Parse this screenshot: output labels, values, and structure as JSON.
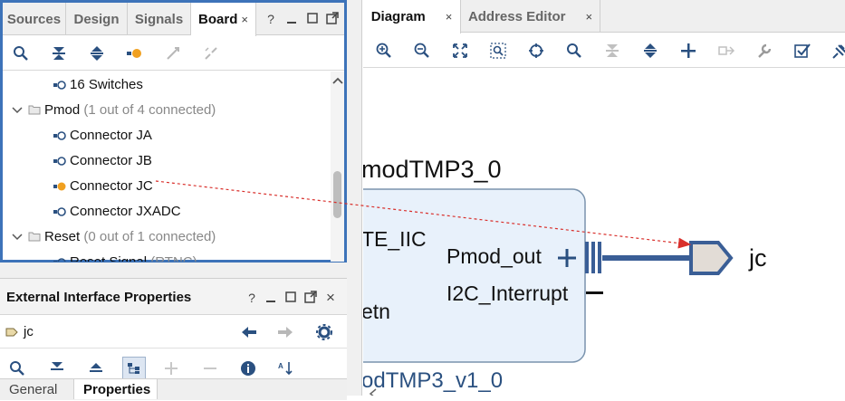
{
  "board": {
    "tabs": [
      {
        "label": "Sources",
        "active": false
      },
      {
        "label": "Design",
        "active": false
      },
      {
        "label": "Signals",
        "active": false
      },
      {
        "label": "Board",
        "active": true
      }
    ],
    "window_buttons": [
      "?",
      "_",
      "□",
      "⤢"
    ],
    "toolbar_icons": [
      "search-icon",
      "collapse-all-icon",
      "expand-all-icon",
      "auto-connect-icon",
      "connect-icon",
      "disconnect-icon"
    ],
    "tree": [
      {
        "label": "16 Switches",
        "meta": "",
        "type": "connector",
        "connected": false
      },
      {
        "label": "Pmod",
        "meta": "(1 out of 4 connected)",
        "type": "folder"
      },
      {
        "label": "Connector JA",
        "meta": "",
        "type": "connector",
        "connected": false
      },
      {
        "label": "Connector JB",
        "meta": "",
        "type": "connector",
        "connected": false
      },
      {
        "label": "Connector JC",
        "meta": "",
        "type": "connector",
        "connected": true
      },
      {
        "label": "Connector JXADC",
        "meta": "",
        "type": "connector",
        "connected": false
      },
      {
        "label": "Reset",
        "meta": "(0 out of 1 connected)",
        "type": "folder"
      },
      {
        "label": "Reset Signal",
        "meta": "(RTNC)",
        "type": "connector",
        "connected": false
      }
    ]
  },
  "properties": {
    "title": "External Interface Properties",
    "window_buttons": [
      "?",
      "_",
      "□",
      "⤢",
      "×"
    ],
    "selected_name": "jc",
    "tabs": [
      {
        "label": "General",
        "active": false
      },
      {
        "label": "Properties",
        "active": true
      }
    ]
  },
  "diagram": {
    "tabs": [
      {
        "label": "Diagram",
        "active": true
      },
      {
        "label": "Address Editor",
        "active": false
      }
    ],
    "toolbar_icons": [
      "zoom-in-icon",
      "zoom-out-icon",
      "fit-view-icon",
      "zoom-area-icon",
      "center-icon",
      "search-icon",
      "collapse-all-icon",
      "expand-all-icon",
      "add-ip-icon",
      "make-external-icon",
      "properties-icon",
      "validate-icon",
      "pin-icon"
    ],
    "block": {
      "instance_name": "modTMP3_0",
      "left_ports": [
        "TE_IIC",
        "etn"
      ],
      "right_ports": [
        "Pmod_out",
        "I2C_Interrupt"
      ],
      "ip_name": "odTMP3_v1_0"
    },
    "external_port": "jc"
  },
  "colors": {
    "panel_border": "#3d73b9",
    "accent_orange": "#f0a020",
    "block_fill": "#e8f1fb",
    "block_stroke": "#7a93ad",
    "wire": "#3a5e96",
    "trace_red": "#d9302c"
  }
}
